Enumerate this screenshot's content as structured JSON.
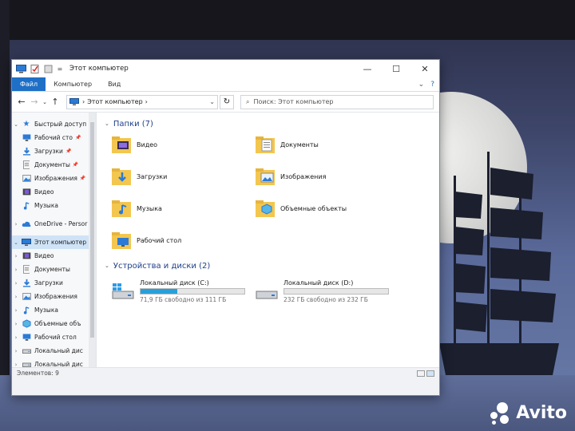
{
  "window": {
    "title": "Этот компьютер",
    "controls": {
      "minimize": "—",
      "maximize": "☐",
      "close": "✕"
    }
  },
  "ribbon": {
    "tabs": [
      "Файл",
      "Компьютер",
      "Вид"
    ],
    "collapse": "⌄",
    "help": "?"
  },
  "address": {
    "path": "Этот компьютер",
    "search_placeholder": "Поиск: Этот компьютер"
  },
  "nav": {
    "quick_access": {
      "label": "Быстрый доступ",
      "items": [
        {
          "label": "Рабочий сто",
          "icon": "desktop-icon",
          "pinned": true
        },
        {
          "label": "Загрузки",
          "icon": "downloads-icon",
          "pinned": true
        },
        {
          "label": "Документы",
          "icon": "documents-icon",
          "pinned": true
        },
        {
          "label": "Изображения",
          "icon": "pictures-icon",
          "pinned": true
        },
        {
          "label": "Видео",
          "icon": "videos-icon",
          "pinned": false
        },
        {
          "label": "Музыка",
          "icon": "music-icon",
          "pinned": false
        }
      ]
    },
    "onedrive": "OneDrive - Persor",
    "this_pc": {
      "label": "Этот компьютер",
      "items": [
        {
          "label": "Видео",
          "icon": "videos-icon"
        },
        {
          "label": "Документы",
          "icon": "documents-icon"
        },
        {
          "label": "Загрузки",
          "icon": "downloads-icon"
        },
        {
          "label": "Изображения",
          "icon": "pictures-icon"
        },
        {
          "label": "Музыка",
          "icon": "music-icon"
        },
        {
          "label": "Объемные объ",
          "icon": "3d-objects-icon"
        },
        {
          "label": "Рабочий стол",
          "icon": "desktop-icon"
        },
        {
          "label": "Локальный дис",
          "icon": "drive-icon"
        },
        {
          "label": "Локальный дис",
          "icon": "drive-icon"
        }
      ]
    }
  },
  "folders_group": {
    "label": "Папки (7)",
    "items": [
      {
        "name": "Видео",
        "icon": "videos-folder-icon"
      },
      {
        "name": "Документы",
        "icon": "documents-folder-icon"
      },
      {
        "name": "Загрузки",
        "icon": "downloads-folder-icon"
      },
      {
        "name": "Изображения",
        "icon": "pictures-folder-icon"
      },
      {
        "name": "Музыка",
        "icon": "music-folder-icon"
      },
      {
        "name": "Объемные объекты",
        "icon": "3d-objects-folder-icon"
      },
      {
        "name": "Рабочий стол",
        "icon": "desktop-folder-icon"
      }
    ]
  },
  "drives_group": {
    "label": "Устройства и диски (2)",
    "items": [
      {
        "name": "Локальный диск (C:)",
        "free": "71,9 ГБ свободно из 111 ГБ",
        "used_fraction": 0.35,
        "icon": "windows-drive-icon"
      },
      {
        "name": "Локальный диск (D:)",
        "free": "232 ГБ свободно из 232 ГБ",
        "used_fraction": 0.0,
        "icon": "drive-icon"
      }
    ]
  },
  "status": {
    "items": "Элементов: 9"
  },
  "watermark": "Avito",
  "colors": {
    "accent": "#1e6fc6",
    "folder": "#f3c64f",
    "drive_fill": "#26a0da",
    "group_header": "#1e3f8a"
  }
}
